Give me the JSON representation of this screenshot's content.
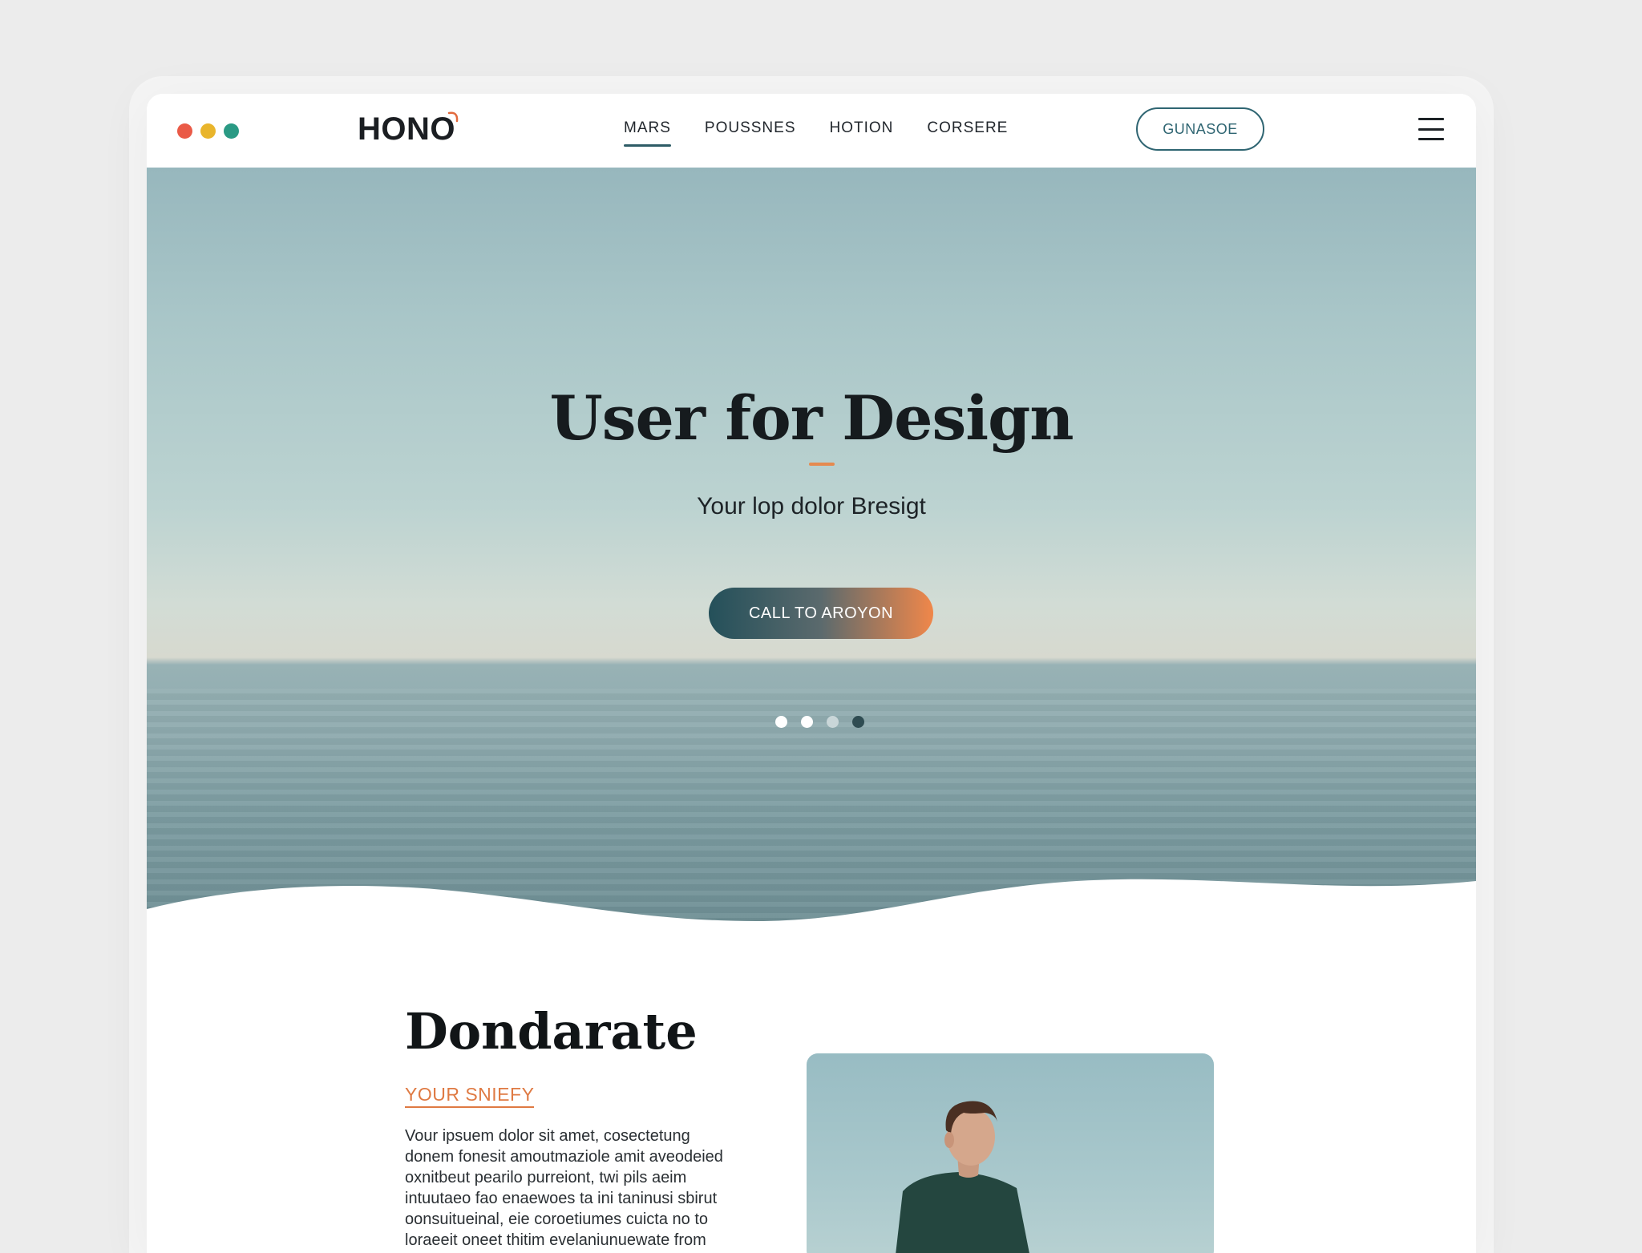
{
  "window": {
    "traffic_lights": [
      "#ea5a47",
      "#e9b52c",
      "#2a9a84"
    ]
  },
  "header": {
    "logo": "HONO",
    "logo_accent_color": "#e26a3e",
    "nav": [
      {
        "label": "MARS",
        "active": true
      },
      {
        "label": "POUSSNES",
        "active": false
      },
      {
        "label": "HOTION",
        "active": false
      },
      {
        "label": "CORSERE",
        "active": false
      }
    ],
    "outline_button": "GUNASOE",
    "menu_icon": "hamburger-menu-icon"
  },
  "hero": {
    "title": "User for Design",
    "subtitle": "Your lop dolor Bresigt",
    "cta_label": "CALL TO AROYON",
    "carousel": {
      "count": 4,
      "active_index": 3
    }
  },
  "about": {
    "title": "Dondarate",
    "kicker": "YOUR SNIEFY",
    "body": "Vour ipsuem dolor sit amet, cosectetung donem fonesit amoutmaziole amit aveodeied oxnitbeut pearilo purreiont, twi pils aeim intuutaeo fao enaewoes ta ini taninusi sbirut oonsuitueinal, eie coroetiumes cuicta no to loraeeit oneet thitim evelaniunuewate from"
  },
  "colors": {
    "accent": "#e58a4f",
    "primary": "#2f6572",
    "text": "#161b1e"
  }
}
